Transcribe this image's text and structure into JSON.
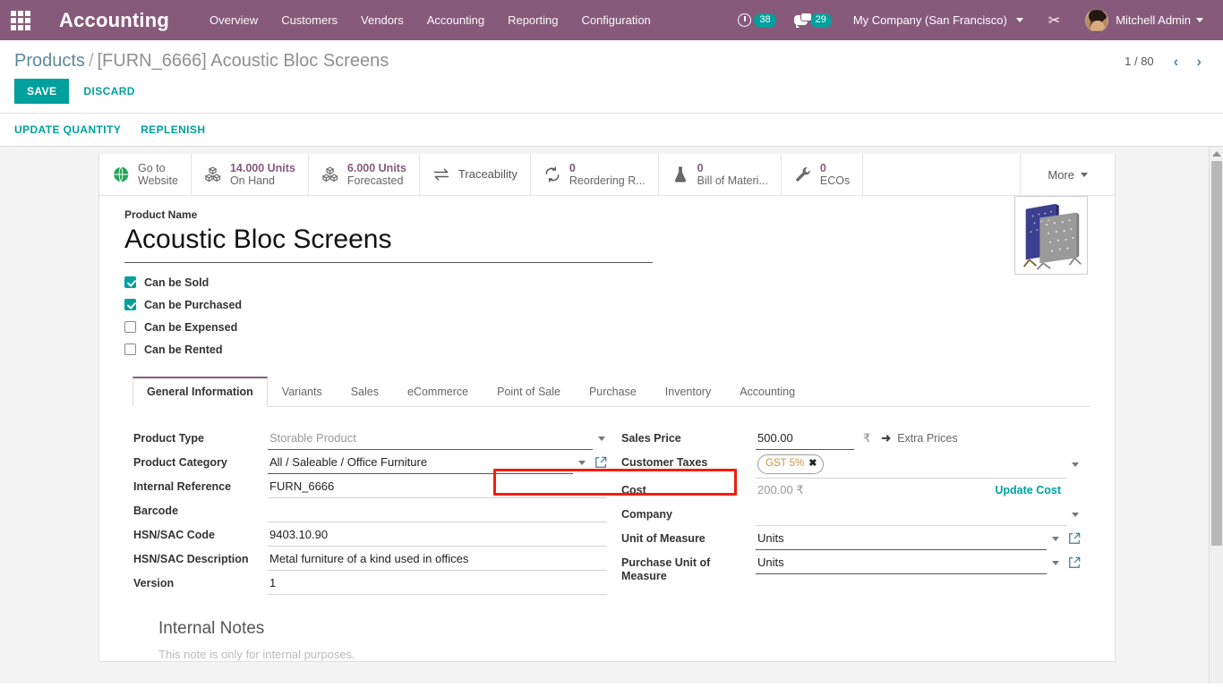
{
  "navbar": {
    "apps_icon": "apps-grid-icon",
    "brand": "Accounting",
    "menu": [
      {
        "label": "Overview"
      },
      {
        "label": "Customers"
      },
      {
        "label": "Vendors"
      },
      {
        "label": "Accounting"
      },
      {
        "label": "Reporting"
      },
      {
        "label": "Configuration"
      }
    ],
    "activity_count": "38",
    "messages_count": "29",
    "company": "My Company (San Francisco)",
    "tools_icon": "tools-icon",
    "user": "Mitchell Admin",
    "accent": "#875a7b"
  },
  "breadcrumb": {
    "root": "Products",
    "separator": "/",
    "current": "[FURN_6666] Acoustic Bloc Screens"
  },
  "pager": {
    "count": "1 / 80",
    "prev": "‹",
    "next": "›"
  },
  "toolbar": {
    "save_label": "SAVE",
    "discard_label": "DISCARD",
    "actions": [
      {
        "label": "UPDATE QUANTITY"
      },
      {
        "label": "REPLENISH"
      }
    ],
    "save_color": "#00a09d"
  },
  "stat_buttons": [
    {
      "icon": "globe-icon",
      "value": "",
      "line1": "Go to",
      "line2": "Website"
    },
    {
      "icon": "boxes-icon",
      "value": "14.000 Units",
      "line1": "",
      "line2": "On Hand"
    },
    {
      "icon": "boxes-icon",
      "value": "6.000 Units",
      "line1": "",
      "line2": "Forecasted"
    },
    {
      "icon": "exchange-icon",
      "value": "",
      "line1": "",
      "line2": "Traceability"
    },
    {
      "icon": "refresh-icon",
      "value": "0",
      "line1": "",
      "line2": "Reordering R..."
    },
    {
      "icon": "flask-icon",
      "value": "0",
      "line1": "",
      "line2": "Bill of Materi..."
    },
    {
      "icon": "wrench-icon",
      "value": "0",
      "line1": "",
      "line2": "ECOs"
    }
  ],
  "stat_more": "More",
  "product": {
    "name_label": "Product Name",
    "name": "Acoustic Bloc Screens",
    "image_alt": "acoustic-bloc-screens-thumbnail",
    "checkboxes": [
      {
        "label": "Can be Sold",
        "checked": true
      },
      {
        "label": "Can be Purchased",
        "checked": true
      },
      {
        "label": "Can be Expensed",
        "checked": false
      },
      {
        "label": "Can be Rented",
        "checked": false
      }
    ]
  },
  "tabs": [
    {
      "label": "General Information",
      "active": true
    },
    {
      "label": "Variants",
      "active": false
    },
    {
      "label": "Sales",
      "active": false
    },
    {
      "label": "eCommerce",
      "active": false
    },
    {
      "label": "Point of Sale",
      "active": false
    },
    {
      "label": "Purchase",
      "active": false
    },
    {
      "label": "Inventory",
      "active": false
    },
    {
      "label": "Accounting",
      "active": false
    }
  ],
  "form_left": {
    "product_type_label": "Product Type",
    "product_type_value": "Storable Product",
    "product_category_label": "Product Category",
    "product_category_value": "All / Saleable / Office Furniture",
    "internal_reference_label": "Internal Reference",
    "internal_reference_value": "FURN_6666",
    "barcode_label": "Barcode",
    "barcode_value": "",
    "hsn_code_label": "HSN/SAC Code",
    "hsn_code_value": "9403.10.90",
    "hsn_desc_label": "HSN/SAC Description",
    "hsn_desc_value": "Metal furniture of a kind used in offices",
    "version_label": "Version",
    "version_value": "1"
  },
  "form_right": {
    "sales_price_label": "Sales Price",
    "sales_price_value": "500.00",
    "currency_symbol": "₹",
    "extra_prices_label": "Extra Prices",
    "customer_taxes_label": "Customer Taxes",
    "customer_taxes_tag": "GST 5%",
    "customer_taxes_tag_remove": "✖",
    "cost_label": "Cost",
    "cost_value": "200.00 ₹",
    "update_cost_label": "Update Cost",
    "company_label": "Company",
    "company_value": "",
    "uom_label": "Unit of Measure",
    "uom_value": "Units",
    "purchase_uom_label": "Purchase Unit of Measure",
    "purchase_uom_value": "Units"
  },
  "highlight": {
    "target": "customer-taxes-field",
    "color": "#f51d0a"
  },
  "notes": {
    "title": "Internal Notes",
    "placeholder": "This note is only for internal purposes."
  }
}
